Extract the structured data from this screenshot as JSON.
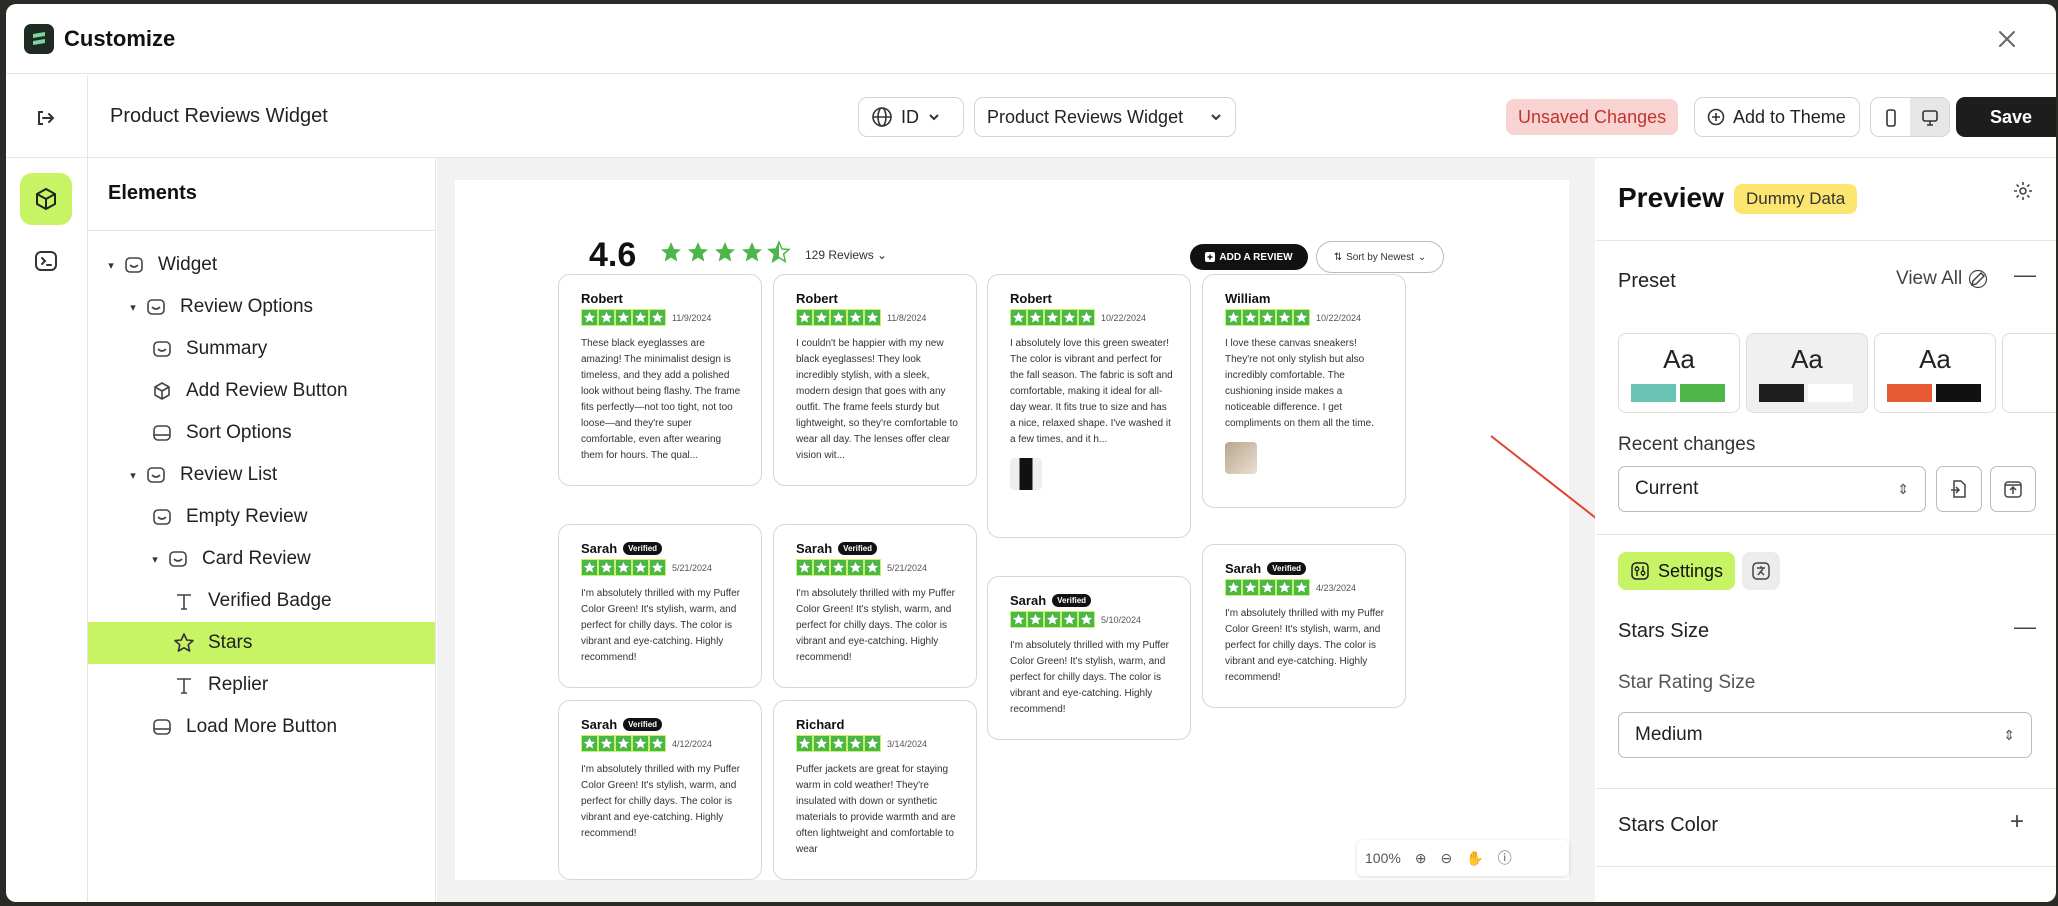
{
  "app": {
    "title": "Customize"
  },
  "toolbar": {
    "page_title": "Product Reviews Widget",
    "language": "ID",
    "widget_select": "Product Reviews Widget",
    "unsaved": "Unsaved Changes",
    "add_to_theme": "Add to Theme",
    "save": "Save"
  },
  "sidebar": {
    "title": "Elements",
    "items": [
      {
        "label": "Widget"
      },
      {
        "label": "Review Options"
      },
      {
        "label": "Summary"
      },
      {
        "label": "Add Review Button"
      },
      {
        "label": "Sort Options"
      },
      {
        "label": "Review List"
      },
      {
        "label": "Empty Review"
      },
      {
        "label": "Card Review"
      },
      {
        "label": "Verified Badge"
      },
      {
        "label": "Stars"
      },
      {
        "label": "Replier"
      },
      {
        "label": "Load More Button"
      }
    ]
  },
  "preview": {
    "score": "4.6",
    "review_count": "129 Reviews",
    "add_review": "ADD A REVIEW",
    "sort": "Sort by Newest",
    "verified": "Verified",
    "zoom": "100%",
    "cards": [
      {
        "name": "Robert",
        "date": "11/9/2024",
        "text": "These black eyeglasses are amazing! The minimalist design is timeless, and they add a polished look without being flashy. The frame fits perfectly—not too tight, not too loose—and they're super comfortable, even after wearing them for hours. The qual..."
      },
      {
        "name": "Sarah",
        "date": "5/21/2024",
        "text": "I'm absolutely thrilled with my Puffer Color Green! It's stylish, warm, and perfect for chilly days. The color is vibrant and eye-catching. Highly recommend!"
      },
      {
        "name": "Sarah",
        "date": "4/12/2024",
        "text": "I'm absolutely thrilled with my Puffer Color Green! It's stylish, warm, and perfect for chilly days. The color is vibrant and eye-catching. Highly recommend!"
      },
      {
        "name": "Robert",
        "date": "11/8/2024",
        "text": "I couldn't be happier with my new black eyeglasses! They look incredibly stylish, with a sleek, modern design that goes with any outfit. The frame feels sturdy but lightweight, so they're comfortable to wear all day. The lenses offer clear vision wit..."
      },
      {
        "name": "Sarah",
        "date": "5/21/2024",
        "text": "I'm absolutely thrilled with my Puffer Color Green! It's stylish, warm, and perfect for chilly days. The color is vibrant and eye-catching. Highly recommend!"
      },
      {
        "name": "Richard",
        "date": "3/14/2024",
        "text": "Puffer jackets are great for staying warm in cold weather! They're insulated with down or synthetic materials to provide warmth and are often lightweight and comfortable to wear"
      },
      {
        "name": "Robert",
        "date": "10/22/2024",
        "text": "I absolutely love this green sweater! The color is vibrant and perfect for the fall season. The fabric is soft and comfortable, making it ideal for all-day wear. It fits true to size and has a nice, relaxed shape. I've washed it a few times, and it h..."
      },
      {
        "name": "Sarah",
        "date": "5/10/2024",
        "text": "I'm absolutely thrilled with my Puffer Color Green! It's stylish, warm, and perfect for chilly days. The color is vibrant and eye-catching. Highly recommend!"
      },
      {
        "name": "William",
        "date": "10/22/2024",
        "text": "I love these canvas sneakers! They're not only stylish but also incredibly comfortable. The cushioning inside makes a noticeable difference. I get compliments on them all the time."
      },
      {
        "name": "Sarah",
        "date": "4/23/2024",
        "text": "I'm absolutely thrilled with my Puffer Color Green! It's stylish, warm, and perfect for chilly days. The color is vibrant and eye-catching. Highly recommend!"
      }
    ]
  },
  "panel": {
    "title": "Preview",
    "badge": "Dummy Data",
    "preset_label": "Preset",
    "view_all": "View All",
    "preset_sample": "Aa",
    "recent_label": "Recent changes",
    "recent_value": "Current",
    "settings_tab": "Settings",
    "stars_size_title": "Stars Size",
    "star_rating_label": "Star Rating Size",
    "star_rating_value": "Medium",
    "stars_color_title": "Stars Color"
  },
  "colors": {
    "accent": "#c7f464",
    "star": "#4cb648",
    "unsaved_bg": "#f9d3d1",
    "dummy_bg": "#fde66f"
  }
}
